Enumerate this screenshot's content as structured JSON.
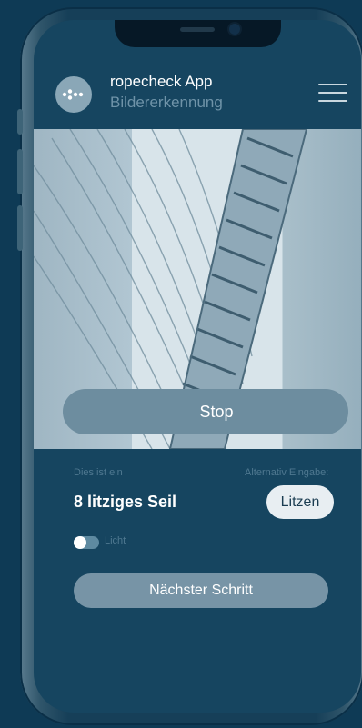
{
  "header": {
    "app_title": "ropecheck App",
    "app_subtitle": "Bildererkennung"
  },
  "camera": {
    "stop_label": "Stop"
  },
  "result": {
    "intro_label": "Dies ist ein",
    "alt_label": "Alternativ Eingabe:",
    "detected": "8 litziges Seil",
    "alt_button": "Litzen"
  },
  "light": {
    "label": "Licht",
    "on": false
  },
  "next_button": "Nächster Schritt",
  "icons": {
    "logo": "dots-logo-icon",
    "menu": "hamburger-menu-icon"
  },
  "colors": {
    "background": "#0e3a55",
    "screen": "#164560",
    "button": "#6d8d9f",
    "next_button": "#7794a6"
  }
}
